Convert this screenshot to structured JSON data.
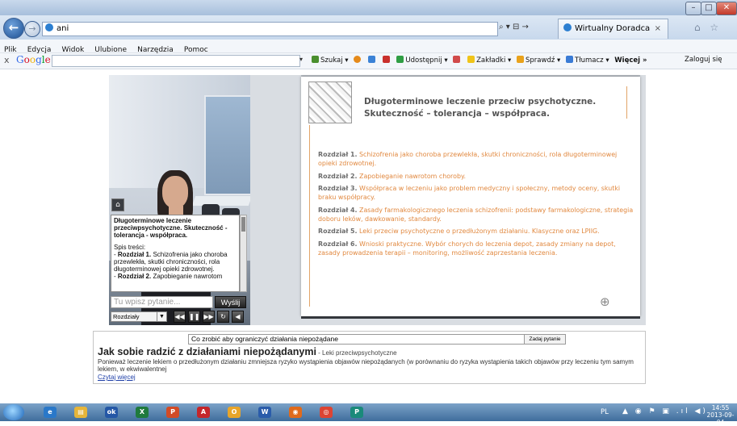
{
  "window": {
    "title": "",
    "controls": {
      "minimize": "–",
      "maximize": "□",
      "close": "✕"
    }
  },
  "browser": {
    "address": "ani",
    "address_actions": "⌕ ▾ ⊟ →",
    "tab_label": "Wirtualny Doradca",
    "tab_close": "×",
    "right_icons": "⌂ ☆",
    "menu": [
      "Plik",
      "Edycja",
      "Widok",
      "Ulubione",
      "Narzędzia",
      "Pomoc"
    ],
    "google_toolbar": {
      "close": "x",
      "logo": "Google",
      "dropdown": "▾",
      "search": "Szukaj ▾",
      "share": "Udostępnij ▾",
      "bookmarks": "Zakładki ▾",
      "check": "Sprawdź ▾",
      "translate": "Tłumacz ▾",
      "more": "Więcej »",
      "login": "Zaloguj się"
    }
  },
  "player": {
    "home_icon": "⌂",
    "info_title": "Długoterminowe leczenie przeciwpsychotyczne. Skuteczność - tolerancja - współpraca.",
    "info_toc_heading": "Spis treści:",
    "info_items": [
      {
        "label": "Rozdział 1.",
        "text": " Schizofrenia jako choroba przewlekła, skutki chroniczności, rola długoterminowej opieki zdrowotnej."
      },
      {
        "label": "Rozdział 2.",
        "text": " Zapobieganie nawrotom"
      }
    ],
    "question_placeholder": "Tu wpisz pytanie...",
    "send_label": "Wyślij",
    "chapters_select": "Rozdziały",
    "controls": {
      "prev": "◀◀",
      "pause": "❚❚",
      "next": "▶▶",
      "replay": "↻",
      "sound": "◀"
    }
  },
  "slide": {
    "title_line1": "Długoterminowe leczenie przeciw psychotyczne.",
    "title_line2": "Skuteczność – tolerancja – współpraca.",
    "chapters": [
      {
        "label": "Rozdział 1.",
        "text": " Schizofrenia jako choroba przewlekła, skutki chroniczności, rola długoterminowej opieki zdrowotnej."
      },
      {
        "label": "Rozdział 2.",
        "text": " Zapobieganie nawrotom choroby."
      },
      {
        "label": "Rozdział 3.",
        "text": " Współpraca w leczeniu jako problem medyczny i społeczny, metody oceny, skutki braku współpracy."
      },
      {
        "label": "Rozdział 4.",
        "text": " Zasady farmakologicznego leczenia schizofrenii: podstawy farmakologiczne, strategia doboru leków, dawkowanie, standardy."
      },
      {
        "label": "Rozdział 5.",
        "text": " Leki przeciw psychotyczne o przedłużonym działaniu. Klasyczne oraz LPIIG."
      },
      {
        "label": "Rozdział 6.",
        "text": " Wnioski praktyczne. Wybór chorych do leczenia depot, zasady zmiany na depot, zasady prowadzenia terapii – monitoring, możliwość zaprzestania leczenia."
      }
    ],
    "zoom_icon": "⊕"
  },
  "faq": {
    "question_value": "Co zrobić aby ograniczyć działania niepożądane",
    "ask_button": "Zadaj pytanie",
    "title": "Jak sobie radzić z działaniami niepożądanymi",
    "subtitle": " - Leki przeciwpsychotyczne",
    "text": "Ponieważ leczenie lekiem o przedłużonym działaniu zmniejsza ryzyko wystąpienia objawów niepożądanych (w porównaniu do ryzyka wystąpienia takich objawów przy leczeniu tym samym lekiem, w ekwiwalentnej",
    "read_more": "Czytaj więcej"
  },
  "taskbar": {
    "apps": [
      {
        "name": "ie",
        "label": "e",
        "color": "#2a78c9"
      },
      {
        "name": "explorer",
        "label": "▤",
        "color": "#e6b53a"
      },
      {
        "name": "app-blue",
        "label": "ok",
        "color": "#2457a6"
      },
      {
        "name": "excel",
        "label": "X",
        "color": "#1f7a3d"
      },
      {
        "name": "powerpoint",
        "label": "P",
        "color": "#d24b26"
      },
      {
        "name": "acrobat",
        "label": "A",
        "color": "#c4262b"
      },
      {
        "name": "outlook",
        "label": "O",
        "color": "#e8a52a"
      },
      {
        "name": "word",
        "label": "W",
        "color": "#2a5caa"
      },
      {
        "name": "firefox",
        "label": "◉",
        "color": "#e06a1c"
      },
      {
        "name": "chrome",
        "label": "◎",
        "color": "#dd4433"
      },
      {
        "name": "publisher",
        "label": "P",
        "color": "#1a8a7a"
      }
    ],
    "lang": "PL",
    "tray": "▲ ◉ ⚑ ▣ .ıl ◀)",
    "time": "14:55",
    "date": "2013-09-04"
  }
}
